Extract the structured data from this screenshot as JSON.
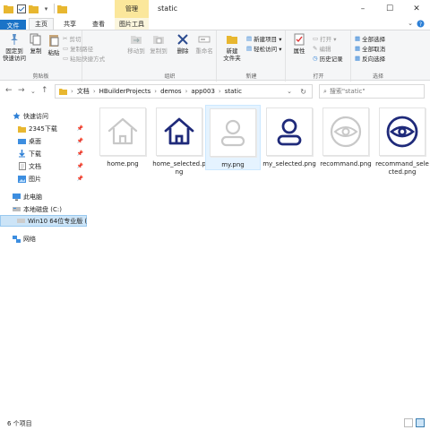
{
  "window": {
    "title": "static",
    "context_tab": "管理",
    "controls": [
      "–",
      "☐",
      "✕"
    ]
  },
  "tabs": {
    "file": "文件",
    "home": "主页",
    "share": "共享",
    "view": "查看",
    "pictools": "图片工具"
  },
  "ribbon": {
    "clipboard": {
      "label": "剪贴板",
      "pin": "固定到\n快速访问",
      "copy": "复制",
      "paste": "粘贴",
      "cut": "剪切",
      "copy_path": "复制路径",
      "paste_shortcut": "粘贴快捷方式"
    },
    "organize": {
      "label": "组织",
      "move_to": "移动到",
      "copy_to": "复制到",
      "delete": "删除",
      "rename": "重命名"
    },
    "new": {
      "label": "新建",
      "new_folder": "新建\n文件夹",
      "new_item": "新建项目 ▾",
      "easy_access": "轻松访问 ▾"
    },
    "open": {
      "label": "打开",
      "properties": "属性",
      "open": "打开 ▾",
      "edit": "编辑",
      "history": "历史记录"
    },
    "select": {
      "label": "选择",
      "select_all": "全部选择",
      "select_none": "全部取消",
      "invert": "反向选择"
    }
  },
  "address": {
    "crumbs": [
      "文档",
      "HBuilderProjects",
      "demos",
      "app003",
      "static"
    ],
    "search_placeholder": "搜索\"static\""
  },
  "nav": {
    "quick_access": "快速访问",
    "items": [
      {
        "label": "2345下载",
        "pinned": true
      },
      {
        "label": "桌面",
        "pinned": true
      },
      {
        "label": "下载",
        "pinned": true
      },
      {
        "label": "文档",
        "pinned": true
      },
      {
        "label": "图片",
        "pinned": true
      }
    ],
    "this_pc": "此电脑",
    "local_disk": "本地磁盘 (C:)",
    "win10": "Win10 64位专业版 (",
    "network": "网络"
  },
  "files": [
    {
      "name": "home.png",
      "icon": "home-outline-icon",
      "color": "#c8c8c8"
    },
    {
      "name": "home_selected.png",
      "icon": "home-filled-icon",
      "color": "#1f2a7a"
    },
    {
      "name": "my.png",
      "icon": "user-outline-icon",
      "color": "#c8c8c8"
    },
    {
      "name": "my_selected.png",
      "icon": "user-filled-icon",
      "color": "#1f2a7a"
    },
    {
      "name": "recommand.png",
      "icon": "eye-outline-icon",
      "color": "#c8c8c8"
    },
    {
      "name": "recommand_selected.png",
      "icon": "eye-filled-icon",
      "color": "#1f2a7a"
    }
  ],
  "status": {
    "count": "6 个项目"
  },
  "colors": {
    "accent": "#1a73c7",
    "icon_gray": "#c8c8c8",
    "icon_navy": "#1f2a7a",
    "context_tab": "#fbe79b"
  }
}
